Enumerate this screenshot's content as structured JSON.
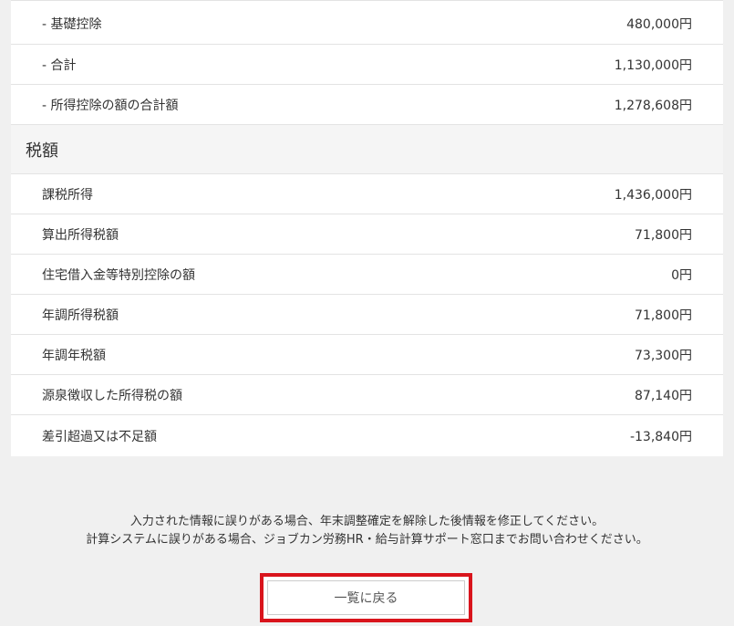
{
  "deduction_rows": [
    {
      "label": "- 基礎控除",
      "value": "480,000円"
    },
    {
      "label": "- 合計",
      "value": "1,130,000円"
    },
    {
      "label": "- 所得控除の額の合計額",
      "value": "1,278,608円"
    }
  ],
  "tax_section": {
    "title": "税額",
    "rows": [
      {
        "label": "課税所得",
        "value": "1,436,000円"
      },
      {
        "label": "算出所得税額",
        "value": "71,800円"
      },
      {
        "label": "住宅借入金等特別控除の額",
        "value": "0円"
      },
      {
        "label": "年調所得税額",
        "value": "71,800円"
      },
      {
        "label": "年調年税額",
        "value": "73,300円"
      },
      {
        "label": "源泉徴収した所得税の額",
        "value": "87,140円"
      },
      {
        "label": "差引超過又は不足額",
        "value": "-13,840円"
      }
    ]
  },
  "notice": {
    "line1": "入力された情報に誤りがある場合、年末調整確定を解除した後情報を修正してください。",
    "line2": "計算システムに誤りがある場合、ジョブカン労務HR・給与計算サポート窓口までお問い合わせください。"
  },
  "back_button": {
    "label": "一覧に戻る"
  },
  "colors": {
    "highlight": "#d9141c",
    "background": "#f0f0f0"
  }
}
